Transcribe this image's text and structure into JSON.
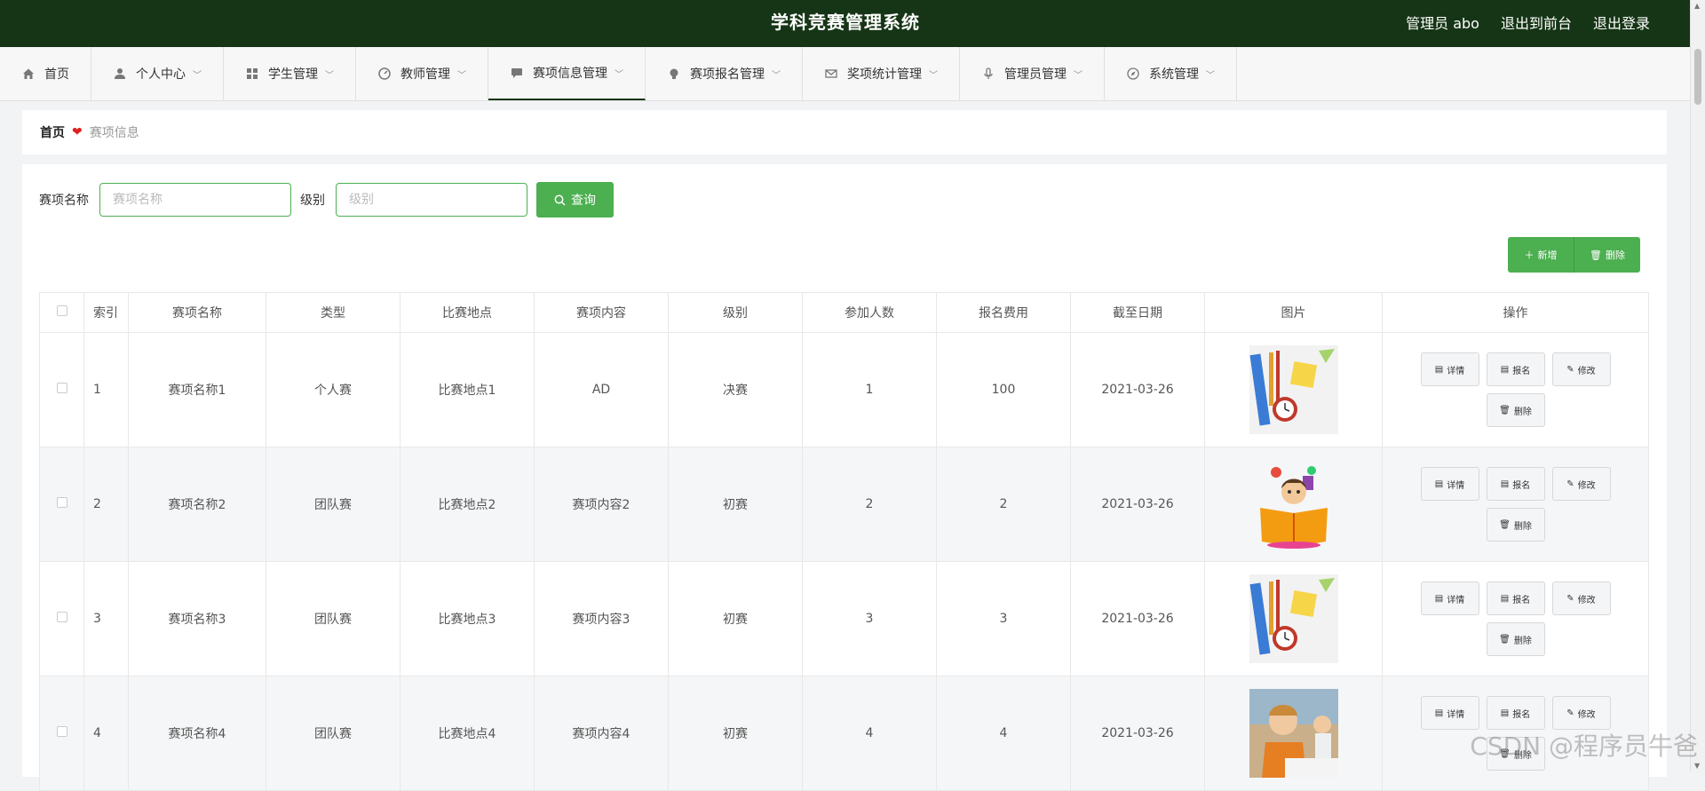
{
  "header": {
    "title": "学科竞赛管理系统",
    "user": "管理员 abo",
    "back_to_front": "退出到前台",
    "logout": "退出登录"
  },
  "nav": {
    "items": [
      {
        "label": "首页",
        "icon": "home-icon"
      },
      {
        "label": "个人中心",
        "icon": "user-icon"
      },
      {
        "label": "学生管理",
        "icon": "grid-icon"
      },
      {
        "label": "教师管理",
        "icon": "gauge-icon"
      },
      {
        "label": "赛项信息管理",
        "icon": "chat-icon"
      },
      {
        "label": "赛项报名管理",
        "icon": "bulb-icon"
      },
      {
        "label": "奖项统计管理",
        "icon": "mail-icon"
      },
      {
        "label": "管理员管理",
        "icon": "mic-icon"
      },
      {
        "label": "系统管理",
        "icon": "compass-icon"
      }
    ],
    "active": "赛项信息管理"
  },
  "breadcrumb": {
    "home": "首页",
    "current": "赛项信息"
  },
  "search": {
    "name_label": "赛项名称",
    "name_placeholder": "赛项名称",
    "level_label": "级别",
    "level_placeholder": "级别",
    "query_button": "查询"
  },
  "toolbar": {
    "add": "新增",
    "delete": "删除"
  },
  "table": {
    "headers": [
      "索引",
      "赛项名称",
      "类型",
      "比赛地点",
      "赛项内容",
      "级别",
      "参加人数",
      "报名费用",
      "截至日期",
      "图片",
      "操作"
    ],
    "rows": [
      {
        "index": "1",
        "name": "赛项名称1",
        "type": "个人赛",
        "place": "比赛地点1",
        "content": "AD",
        "level": "决赛",
        "count": "1",
        "fee": "100",
        "date": "2021-03-26",
        "image": "stationery"
      },
      {
        "index": "2",
        "name": "赛项名称2",
        "type": "团队赛",
        "place": "比赛地点2",
        "content": "赛项内容2",
        "level": "初赛",
        "count": "2",
        "fee": "2",
        "date": "2021-03-26",
        "image": "reading-child"
      },
      {
        "index": "3",
        "name": "赛项名称3",
        "type": "团队赛",
        "place": "比赛地点3",
        "content": "赛项内容3",
        "level": "初赛",
        "count": "3",
        "fee": "3",
        "date": "2021-03-26",
        "image": "stationery"
      },
      {
        "index": "4",
        "name": "赛项名称4",
        "type": "团队赛",
        "place": "比赛地点4",
        "content": "赛项内容4",
        "level": "初赛",
        "count": "4",
        "fee": "4",
        "date": "2021-03-26",
        "image": "student-writing"
      }
    ],
    "row_actions": {
      "detail": "详情",
      "signup": "报名",
      "edit": "修改",
      "delete": "删除"
    }
  },
  "watermark": "CSDN @程序员牛爸",
  "colors": {
    "header_bg": "#163516",
    "accent": "#4caf50"
  }
}
